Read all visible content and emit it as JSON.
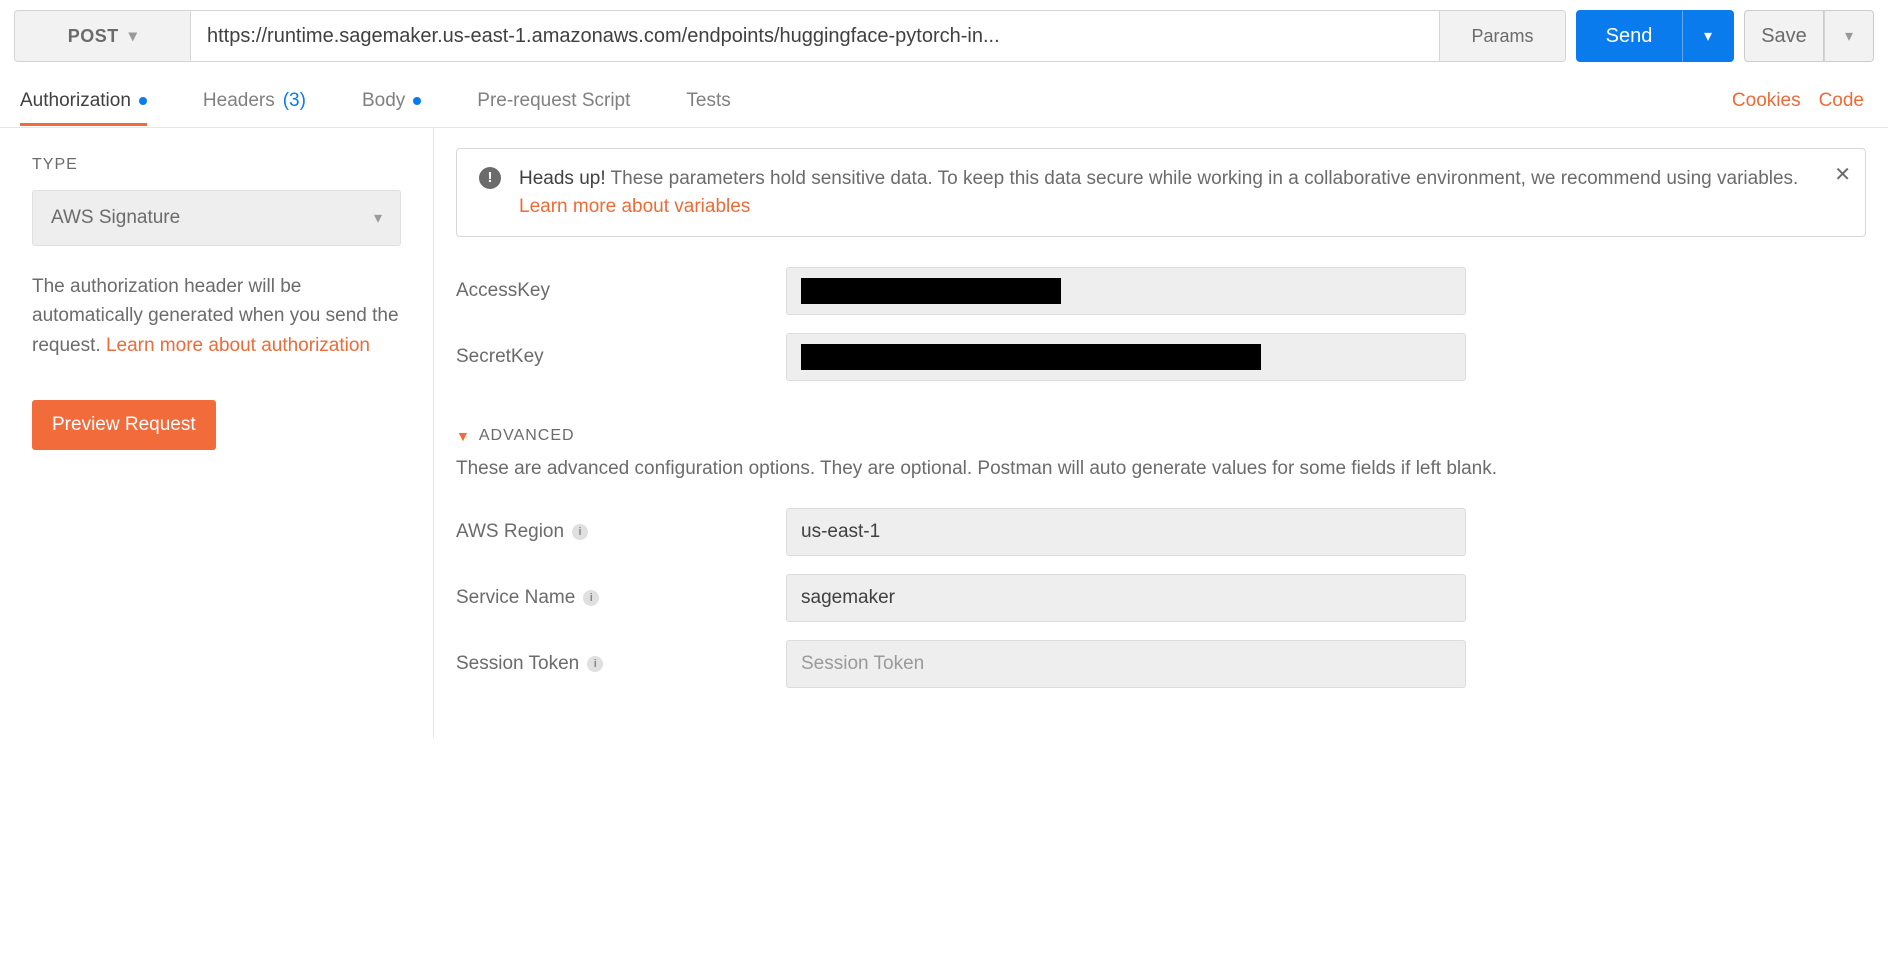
{
  "request": {
    "method": "POST",
    "url": "https://runtime.sagemaker.us-east-1.amazonaws.com/endpoints/huggingface-pytorch-in...",
    "params_btn": "Params",
    "send": "Send",
    "save": "Save"
  },
  "tabs": {
    "authorization": "Authorization",
    "headers": "Headers",
    "headers_count": "(3)",
    "body": "Body",
    "prerequest": "Pre-request Script",
    "tests": "Tests",
    "cookies": "Cookies",
    "code": "Code"
  },
  "auth": {
    "type_label": "TYPE",
    "type_value": "AWS Signature",
    "helper_1": "The authorization header will be automatically generated when you send the request. ",
    "helper_link": "Learn more about authorization",
    "preview": "Preview Request"
  },
  "alert": {
    "heads": "Heads up!",
    "text": " These parameters hold sensitive data. To keep this data secure while working in a collaborative environment, we recommend using variables. ",
    "link": "Learn more about variables"
  },
  "fields": {
    "access_key": "AccessKey",
    "secret_key": "SecretKey"
  },
  "advanced": {
    "label": "ADVANCED",
    "desc": "These are advanced configuration options. They are optional. Postman will auto generate values for some fields if left blank.",
    "region_label": "AWS Region",
    "region_value": "us-east-1",
    "service_label": "Service Name",
    "service_value": "sagemaker",
    "session_label": "Session Token",
    "session_placeholder": "Session Token"
  }
}
